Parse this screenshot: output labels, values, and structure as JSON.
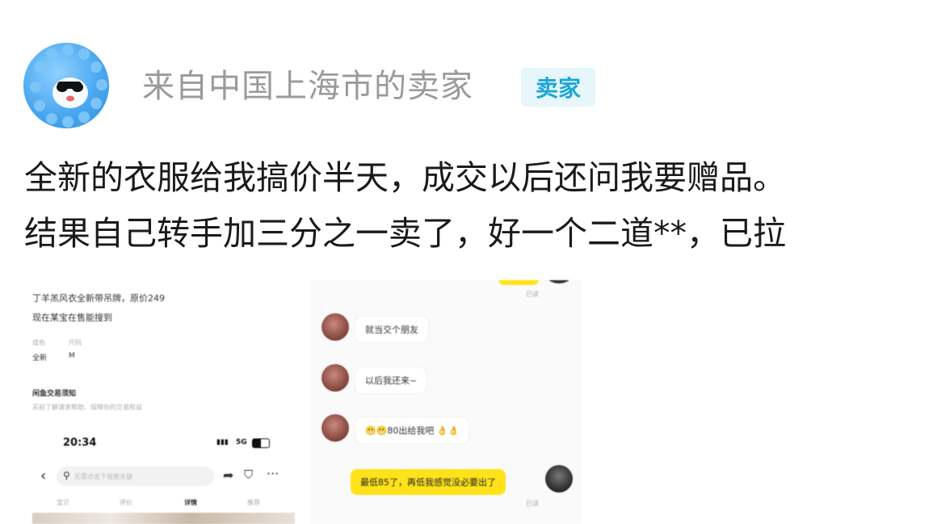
{
  "header": {
    "seller_name": "来自中国上海市的卖家",
    "badge": "卖家"
  },
  "post": {
    "line1": "全新的衣服给我搞价半天，成交以后还问我要赠品。",
    "line2": "结果自己转手加三分之一卖了，好一个二道**，已拉"
  },
  "listing_shot": {
    "title": "丁羊羔风衣全新带吊牌，原价249",
    "subtitle": "现在某宝在售能搜到",
    "attr_label1": "成色",
    "attr_label2": "尺码",
    "attr_value1": "全新",
    "attr_value2": "M",
    "notice_title": "闲鱼交易须知",
    "notice_text": "买前了解请求帮助，保障你的交易权益",
    "status_time": "20:34",
    "status_signal": "5G",
    "search_placeholder": "无需点击下搜索关键",
    "tabs": [
      "宝贝",
      "评价",
      "详情",
      "推荐"
    ]
  },
  "chat_shot": {
    "messages": [
      {
        "side": "in",
        "text": "就当交个朋友"
      },
      {
        "side": "in",
        "text": "以后我还来~"
      },
      {
        "side": "in",
        "text": "😬😬80出给我吧 👌👌"
      },
      {
        "side": "out",
        "text": "最低85了，再低我感觉没必要出了"
      }
    ],
    "read_label": "已读"
  }
}
